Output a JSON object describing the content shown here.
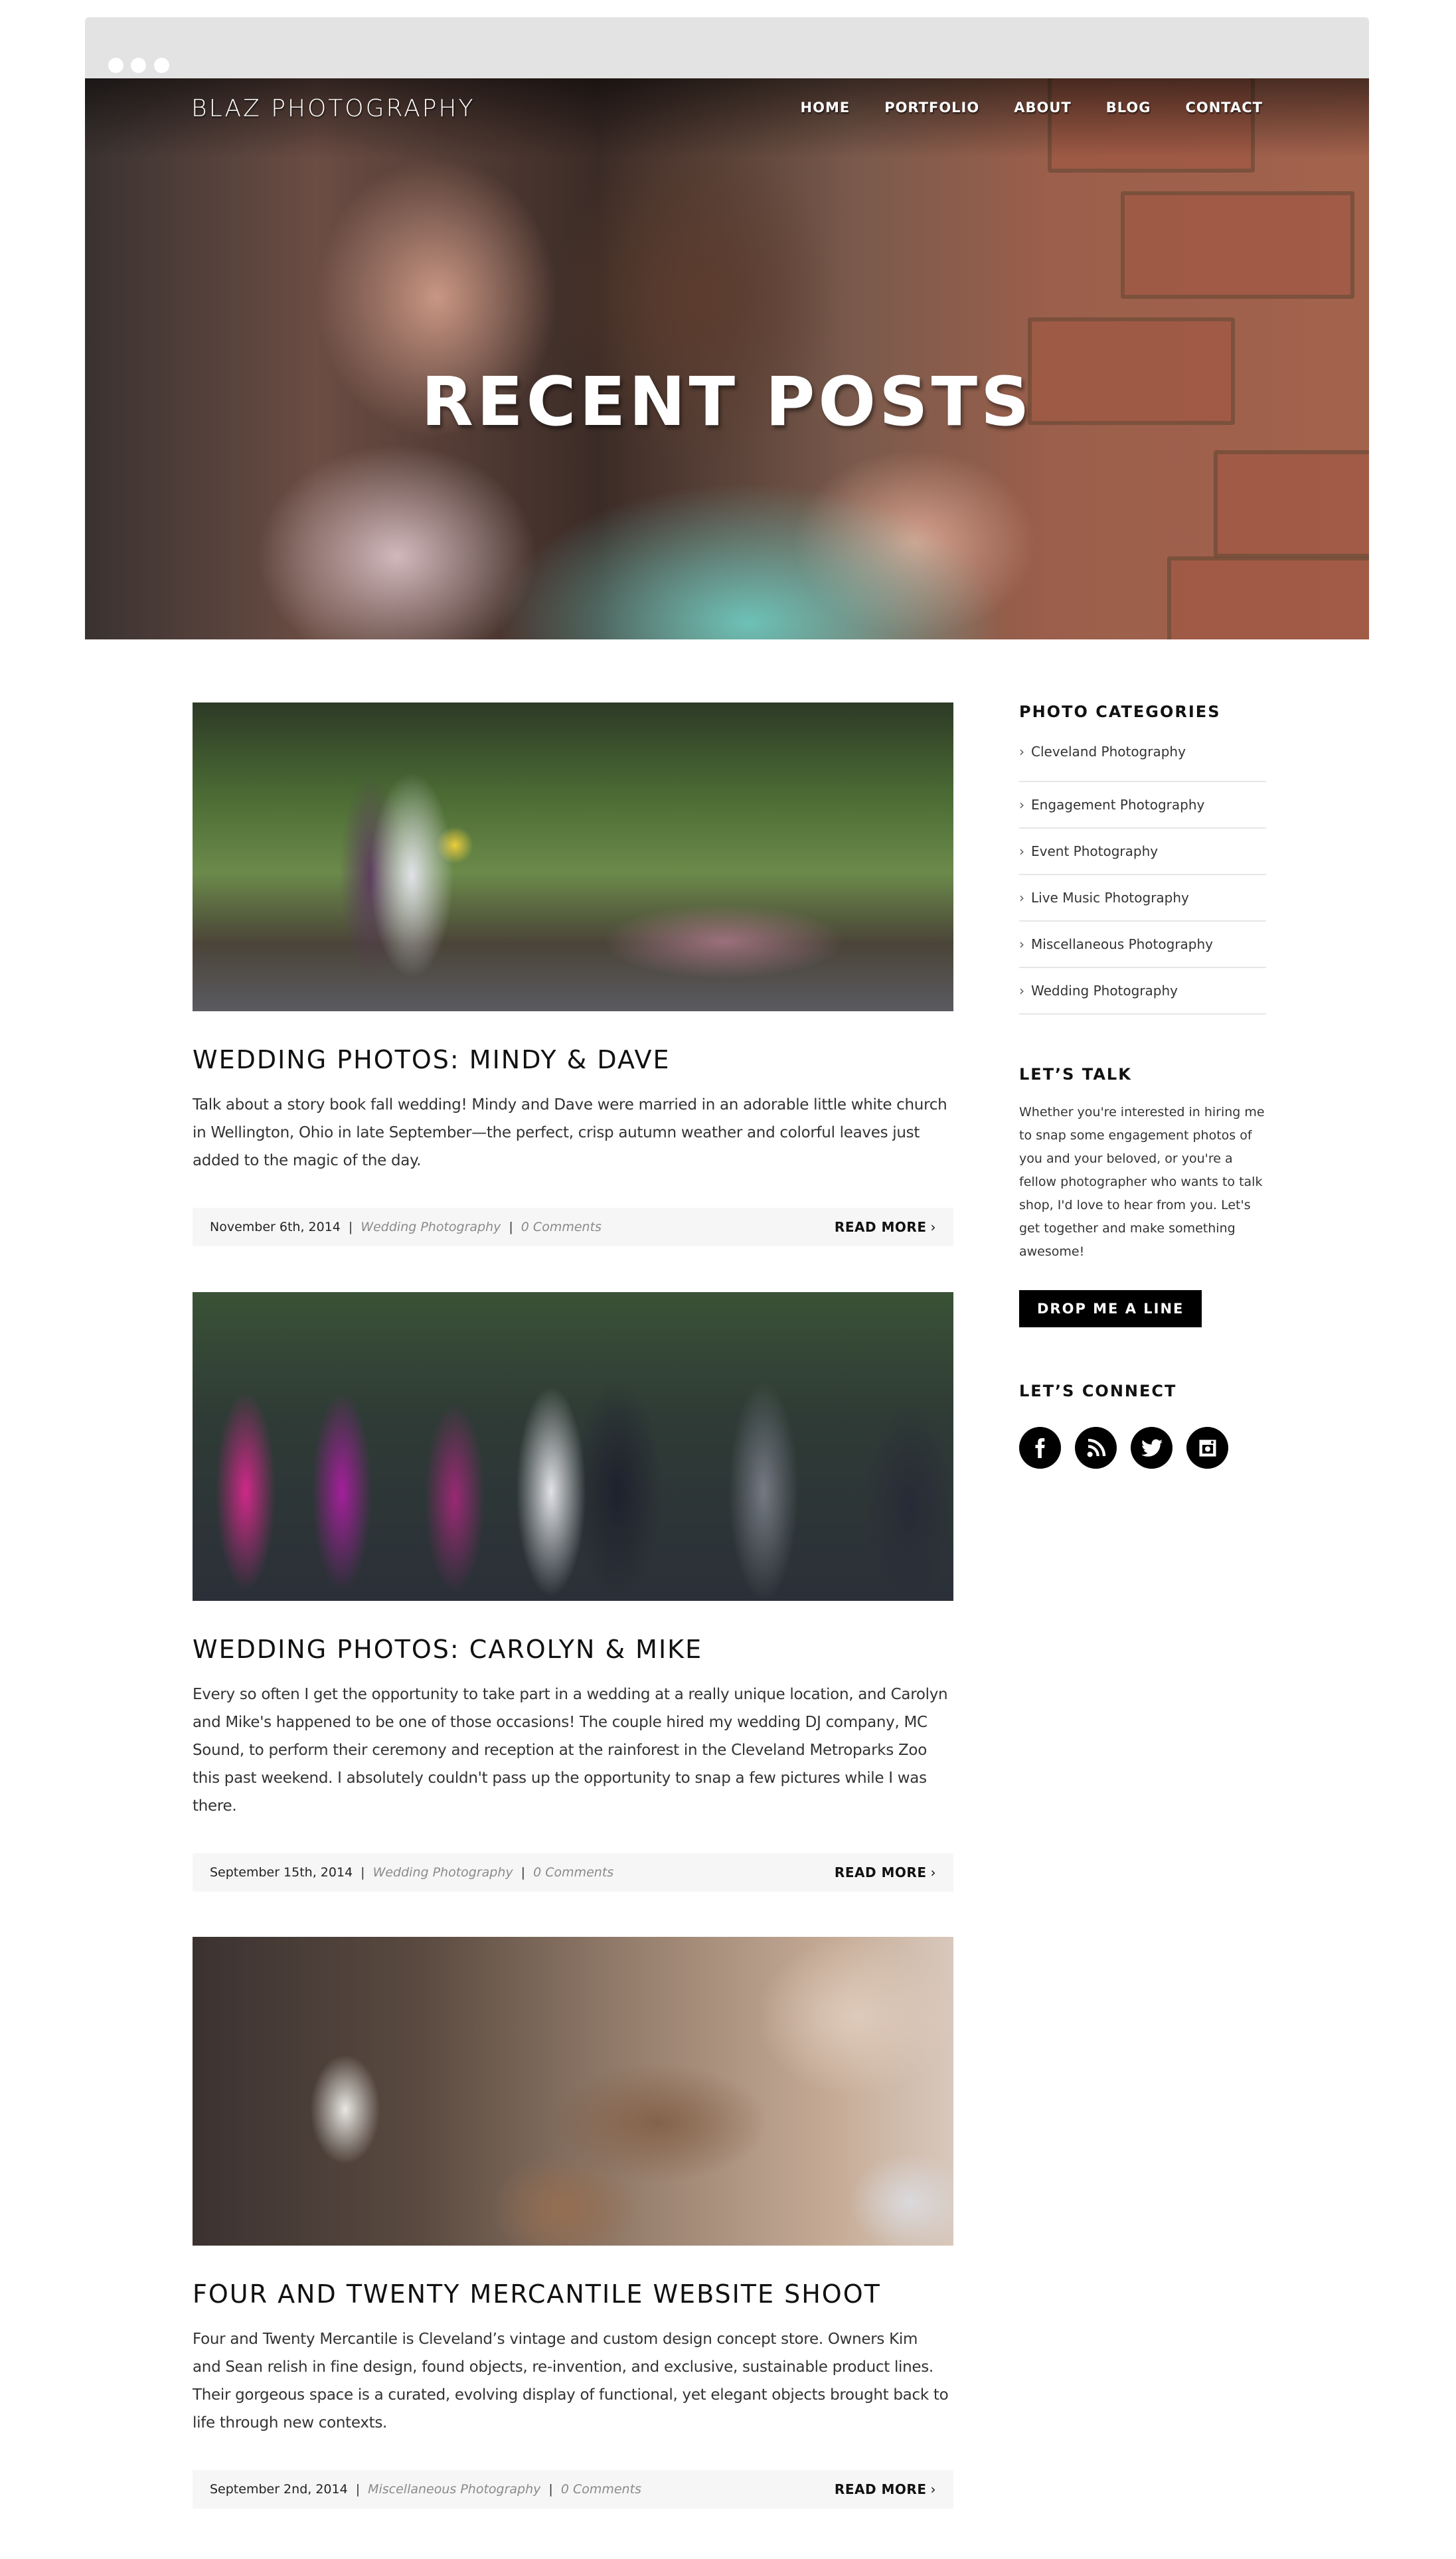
{
  "site": {
    "logo": "BLAZ PHOTOGRAPHY",
    "nav": [
      "HOME",
      "PORTFOLIO",
      "ABOUT",
      "BLOG",
      "CONTACT"
    ],
    "hero_title": "RECENT POSTS"
  },
  "posts": [
    {
      "title": "WEDDING PHOTOS: MINDY & DAVE",
      "excerpt": "Talk about a story book fall wedding! Mindy and Dave were married in an adorable little white church in Wellington, Ohio in late September—the perfect, crisp autumn weather and colorful leaves just added to the magic of the day.",
      "date": "November 6th, 2014",
      "category": "Wedding Photography",
      "comments": "0 Comments",
      "read_more": "READ MORE",
      "image": "wedding couple in front of forest and wooden fence"
    },
    {
      "title": "WEDDING PHOTOS: CAROLYN & MIKE",
      "excerpt": "Every so often I get the opportunity to take part in a wedding at a really unique location, and Carolyn and Mike's happened to be one of those occasions! The couple hired my wedding DJ company, MC Sound, to perform their ceremony and reception at the rainforest in the Cleveland Metroparks Zoo this past weekend. I absolutely couldn't pass up the opportunity to snap a few pictures while I was there.",
      "date": "September 15th, 2014",
      "category": "Wedding Photography",
      "comments": "0 Comments",
      "read_more": "READ MORE",
      "image": "wedding ceremony with bridesmaids and groomsmen"
    },
    {
      "title": "FOUR AND TWENTY MERCANTILE WEBSITE SHOOT",
      "excerpt": "Four and Twenty Mercantile is Cleveland’s vintage and custom design concept store. Owners Kim and Sean relish in fine design, found objects, re-invention, and exclusive, sustainable product lines. Their gorgeous space is a curated, evolving display of functional, yet elegant objects brought back to life through new contexts.",
      "date": "September 2nd, 2014",
      "category": "Miscellaneous Photography",
      "comments": "0 Comments",
      "read_more": "READ MORE",
      "image": "vintage store interior with wooden furniture"
    }
  ],
  "sidebar": {
    "categories_title": "PHOTO CATEGORIES",
    "categories": [
      "Cleveland Photography",
      "Engagement Photography",
      "Event Photography",
      "Live Music Photography",
      "Miscellaneous Photography",
      "Wedding Photography"
    ],
    "talk_title": "LET’S TALK",
    "talk_text": "Whether you're interested in hiring me to snap some engagement photos of you and your beloved, or you're a fellow photographer who wants to talk shop, I'd love to hear from you. Let's get together and make something awesome!",
    "cta_label": "DROP ME A LINE",
    "connect_title": "LET’S CONNECT",
    "social": [
      "facebook-icon",
      "rss-icon",
      "twitter-icon",
      "instagram-icon"
    ]
  },
  "icons": {
    "chevron": "›",
    "separator": "|"
  }
}
